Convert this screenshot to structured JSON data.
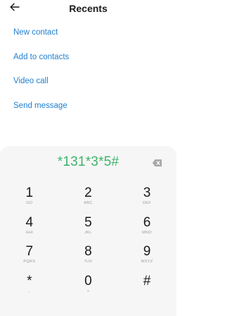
{
  "header": {
    "title": "Recents",
    "back_icon": "arrow-left-icon"
  },
  "actions": [
    {
      "label": "New contact"
    },
    {
      "label": "Add to contacts"
    },
    {
      "label": "Video call"
    },
    {
      "label": "Send message"
    }
  ],
  "dialer": {
    "number": "*131*3*5#",
    "number_color": "#3db36a",
    "backspace_icon": "backspace-icon",
    "keys": [
      {
        "digit": "1",
        "letters": "GO"
      },
      {
        "digit": "2",
        "letters": "ABC"
      },
      {
        "digit": "3",
        "letters": "DEF"
      },
      {
        "digit": "4",
        "letters": "GHI"
      },
      {
        "digit": "5",
        "letters": "JKL"
      },
      {
        "digit": "6",
        "letters": "MNO"
      },
      {
        "digit": "7",
        "letters": "PQRS"
      },
      {
        "digit": "8",
        "letters": "TUV"
      },
      {
        "digit": "9",
        "letters": "WXYZ"
      },
      {
        "digit": "*",
        "letters": ","
      },
      {
        "digit": "0",
        "letters": "+"
      },
      {
        "digit": "#",
        "letters": ""
      }
    ]
  },
  "colors": {
    "link": "#1f7fd1",
    "pad_bg": "#f6f6f6"
  }
}
